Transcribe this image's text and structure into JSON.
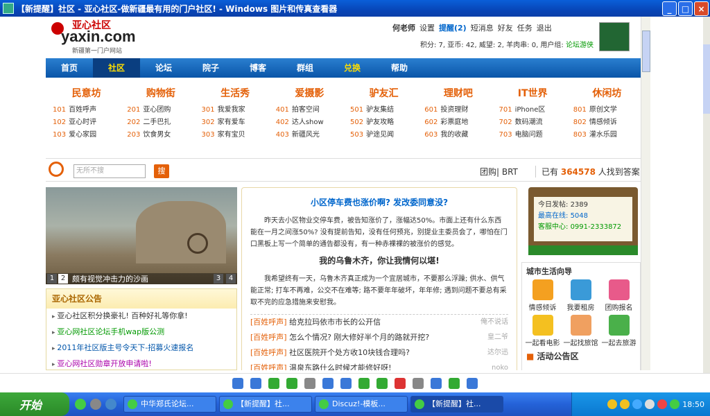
{
  "window": {
    "title": "【新提醒】社区 - 亚心社区-做新疆最有用的门户社区! - Windows 图片和传真查看器"
  },
  "logo": {
    "cn": "亚心社区",
    "en": "yaxin.com",
    "tag": "新疆第一门户网站"
  },
  "userbar": {
    "user": "何老师",
    "settings": "设置",
    "remind": "提醒(2)",
    "sms": "短消息",
    "friends": "好友",
    "tasks": "任务",
    "logout": "退出"
  },
  "stats": {
    "text": "积分: 7, 亚币: 42, 威望: 2, 羊肉串: 0, 用户组:",
    "group": "论坛游侠"
  },
  "nav": [
    "首页",
    "社区",
    "论坛",
    "院子",
    "博客",
    "群组",
    "兑换",
    "帮助"
  ],
  "cats": [
    {
      "h": "民意坊",
      "items": [
        [
          "101",
          "百姓呼声"
        ],
        [
          "102",
          "亚心时评"
        ],
        [
          "103",
          "爱心家园"
        ]
      ]
    },
    {
      "h": "购物街",
      "items": [
        [
          "201",
          "亚心团购"
        ],
        [
          "202",
          "二手巴扎"
        ],
        [
          "203",
          "饮食男女"
        ]
      ]
    },
    {
      "h": "生活秀",
      "items": [
        [
          "301",
          "我爱我家"
        ],
        [
          "302",
          "家有爱车"
        ],
        [
          "303",
          "家有宝贝"
        ]
      ]
    },
    {
      "h": "爱摄影",
      "items": [
        [
          "401",
          "拍客空间"
        ],
        [
          "402",
          "达人show"
        ],
        [
          "403",
          "新疆风光"
        ]
      ]
    },
    {
      "h": "驴友汇",
      "items": [
        [
          "501",
          "驴友集结"
        ],
        [
          "502",
          "驴友攻略"
        ],
        [
          "503",
          "驴途见闻"
        ]
      ]
    },
    {
      "h": "理财吧",
      "items": [
        [
          "601",
          "投资理财"
        ],
        [
          "602",
          "彩票庭地"
        ],
        [
          "603",
          "我的收藏"
        ]
      ]
    },
    {
      "h": "IT世界",
      "items": [
        [
          "701",
          "iPhone区"
        ],
        [
          "702",
          "数码潮流"
        ],
        [
          "703",
          "电脑问题"
        ]
      ]
    },
    {
      "h": "休闲坊",
      "items": [
        [
          "801",
          "原创文学"
        ],
        [
          "802",
          "情感倾诉"
        ],
        [
          "803",
          "灌水乐园"
        ]
      ]
    }
  ],
  "search": {
    "placeholder": "无所不搜",
    "btn": "搜",
    "tuan": "团购| BRT",
    "found_pre": "已有",
    "found_num": "364578",
    "found_post": "人找到答案"
  },
  "slide": {
    "caption": "颇有视觉冲击力的沙画",
    "n1": "1",
    "n2": "2",
    "n3": "3",
    "n4": "4"
  },
  "notice": {
    "title": "亚心社区公告",
    "items": [
      "亚心社区积分换豪礼! 百种好礼等你拿!",
      "亚心网社区论坛手机wap版公测",
      "2011年社区版主号令天下-招募火速报名",
      "亚心网社区勋章开放申请啦!"
    ]
  },
  "article": {
    "title": "小区停车费也涨价啊? 发改委同意没?",
    "p1": "昨天去小区物业交停车费，被告知涨价了，涨幅达50%。市面上还有什么东西能在一月之间涨50%? 没有提前告知，没有任何预兆，别提业主委员会了，哪怕在门口黑板上写一个简单的通告都没有，有一种赤裸裸的被涨价的感觉。",
    "sub": "我的乌鲁木齐，你让我情何以堪!",
    "p2": "我希望终有一天，乌鲁木齐真正成为一个宜居城市，不要那么浮躁; 供水、供气能正常; 打车不再难，公交不在难等; 路不要年年破坏，年年修; 遇到问题不要总有采取不完的应急措施来安慰我。",
    "list": [
      {
        "tag": "[百姓呼声]",
        "title": "给克拉玛依市市长的公开信",
        "au": "俺不说话"
      },
      {
        "tag": "[百姓呼声]",
        "title": "怎么个情况? 刚大修好半个月的路就开挖?",
        "au": "皇二爷"
      },
      {
        "tag": "[百姓呼声]",
        "title": "社区医院开个处方收10块钱合理吗?",
        "au": "达尔迅"
      },
      {
        "tag": "[百姓呼声]",
        "title": "温泉东路什么时候才能修好呀!",
        "au": "noko"
      }
    ]
  },
  "board": {
    "today_label": "今日发帖:",
    "today": "2389",
    "online_label": "最高在线:",
    "online": "5048",
    "phone_label": "客服中心:",
    "phone": "0991-2333872"
  },
  "guide": {
    "title": "城市生活向导",
    "items": [
      "情感倾诉",
      "我要租房",
      "团购报名",
      "一起看电影",
      "一起找旅馆",
      "一起去旅游"
    ],
    "activity": "活动公告区"
  },
  "taskbar": {
    "start": "开始",
    "tasks": [
      "中华郑氏论坛...",
      "【新提醒】社...",
      "Discuz!-模板...",
      "【新提醒】社..."
    ],
    "clock": "18:50"
  }
}
